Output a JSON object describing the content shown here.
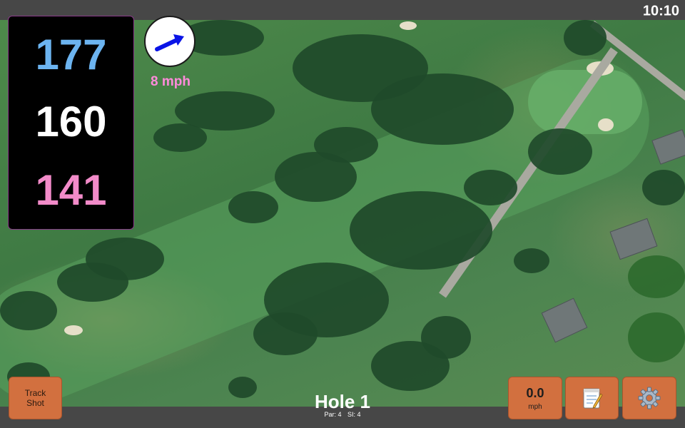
{
  "status_bar": {
    "time": "10:10"
  },
  "yardages": {
    "back": "177",
    "middle": "160",
    "front": "141"
  },
  "wind": {
    "speed_label": "8 mph",
    "arrow_color": "#0a14e6"
  },
  "hole": {
    "title": "Hole 1",
    "par": "Par: 4",
    "si": "SI: 4"
  },
  "buttons": {
    "track_shot_line1": "Track",
    "track_shot_line2": "Shot",
    "speed_value": "0.0",
    "speed_unit": "mph",
    "notes_icon": "notepad-icon",
    "settings_icon": "gear-icon"
  },
  "colors": {
    "accent_button": "#d2703f",
    "yardage_back": "#6cb4f0",
    "yardage_middle": "#ffffff",
    "yardage_front": "#f28bc9",
    "wind_text": "#ff8bdb"
  }
}
